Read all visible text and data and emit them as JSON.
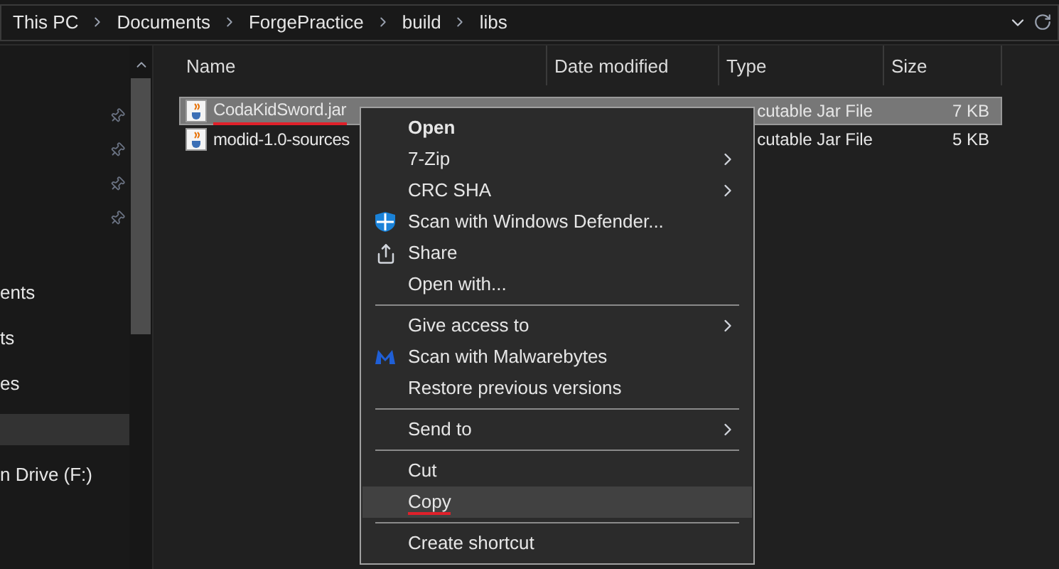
{
  "address_bar": {
    "crumbs": [
      "This PC",
      "Documents",
      "ForgePractice",
      "build",
      "libs"
    ]
  },
  "nav_pane": {
    "items": [
      {
        "label": "ents",
        "selected": false
      },
      {
        "label": "ts",
        "selected": false
      },
      {
        "label": "es",
        "selected": false
      },
      {
        "selected": true
      },
      {
        "label": "n Drive (F:)",
        "selected": false
      }
    ]
  },
  "table": {
    "columns": [
      "Name",
      "Date modified",
      "Type",
      "Size"
    ],
    "rows": [
      {
        "name": "CodaKidSword.jar",
        "type": "cutable Jar File",
        "size": "7 KB",
        "selected": true,
        "underlined": true
      },
      {
        "name": "modid-1.0-sources",
        "type": "cutable Jar File",
        "size": "5 KB",
        "selected": false,
        "underlined": false
      }
    ]
  },
  "context_menu": {
    "items": [
      {
        "kind": "item",
        "label": "Open",
        "bold": true,
        "submenu": false,
        "selected": false
      },
      {
        "kind": "item",
        "label": "7-Zip",
        "submenu": true,
        "selected": false
      },
      {
        "kind": "item",
        "label": "CRC SHA",
        "submenu": true,
        "selected": false
      },
      {
        "kind": "item",
        "label": "Scan with Windows Defender...",
        "submenu": false,
        "selected": false
      },
      {
        "kind": "item",
        "label": "Share",
        "submenu": false,
        "selected": false
      },
      {
        "kind": "item",
        "label": "Open with...",
        "submenu": false,
        "selected": false
      },
      {
        "kind": "separator"
      },
      {
        "kind": "item",
        "label": "Give access to",
        "submenu": true,
        "selected": false
      },
      {
        "kind": "item",
        "label": "Scan with Malwarebytes",
        "submenu": false,
        "selected": false
      },
      {
        "kind": "item",
        "label": "Restore previous versions",
        "submenu": false,
        "selected": false
      },
      {
        "kind": "separator"
      },
      {
        "kind": "item",
        "label": "Send to",
        "submenu": true,
        "selected": false
      },
      {
        "kind": "separator"
      },
      {
        "kind": "item",
        "label": "Cut",
        "submenu": false,
        "selected": false
      },
      {
        "kind": "item",
        "label": "Copy",
        "submenu": false,
        "selected": true,
        "underlined": true
      },
      {
        "kind": "separator"
      },
      {
        "kind": "item",
        "label": "Create shortcut",
        "submenu": false,
        "selected": false
      }
    ]
  }
}
